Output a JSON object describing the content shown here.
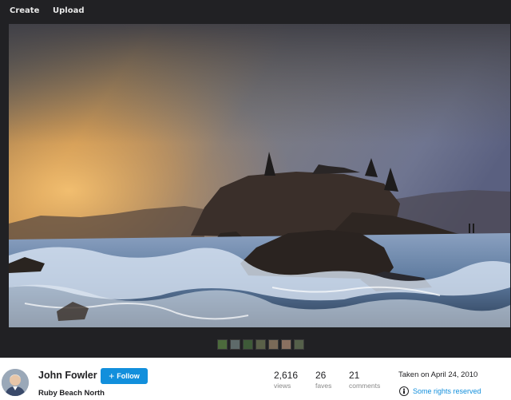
{
  "nav": {
    "create_label": "Create",
    "upload_label": "Upload"
  },
  "photo": {
    "thumbnails": [
      "#4c6a3c",
      "#5e6a6a",
      "#3e5a38",
      "#5a6048",
      "#7a6a58",
      "#8a7060",
      "#55604a"
    ]
  },
  "owner": {
    "name": "John Fowler",
    "follow_label": "Follow"
  },
  "photo_info": {
    "title": "Ruby Beach North",
    "taken": "Taken on April 24, 2010",
    "license": "Some rights reserved"
  },
  "stats": {
    "views": {
      "value": "2,616",
      "label": "views"
    },
    "faves": {
      "value": "26",
      "label": "faves"
    },
    "comments": {
      "value": "21",
      "label": "comments"
    }
  },
  "colors": {
    "accent": "#128fdc",
    "background": "#212124"
  }
}
